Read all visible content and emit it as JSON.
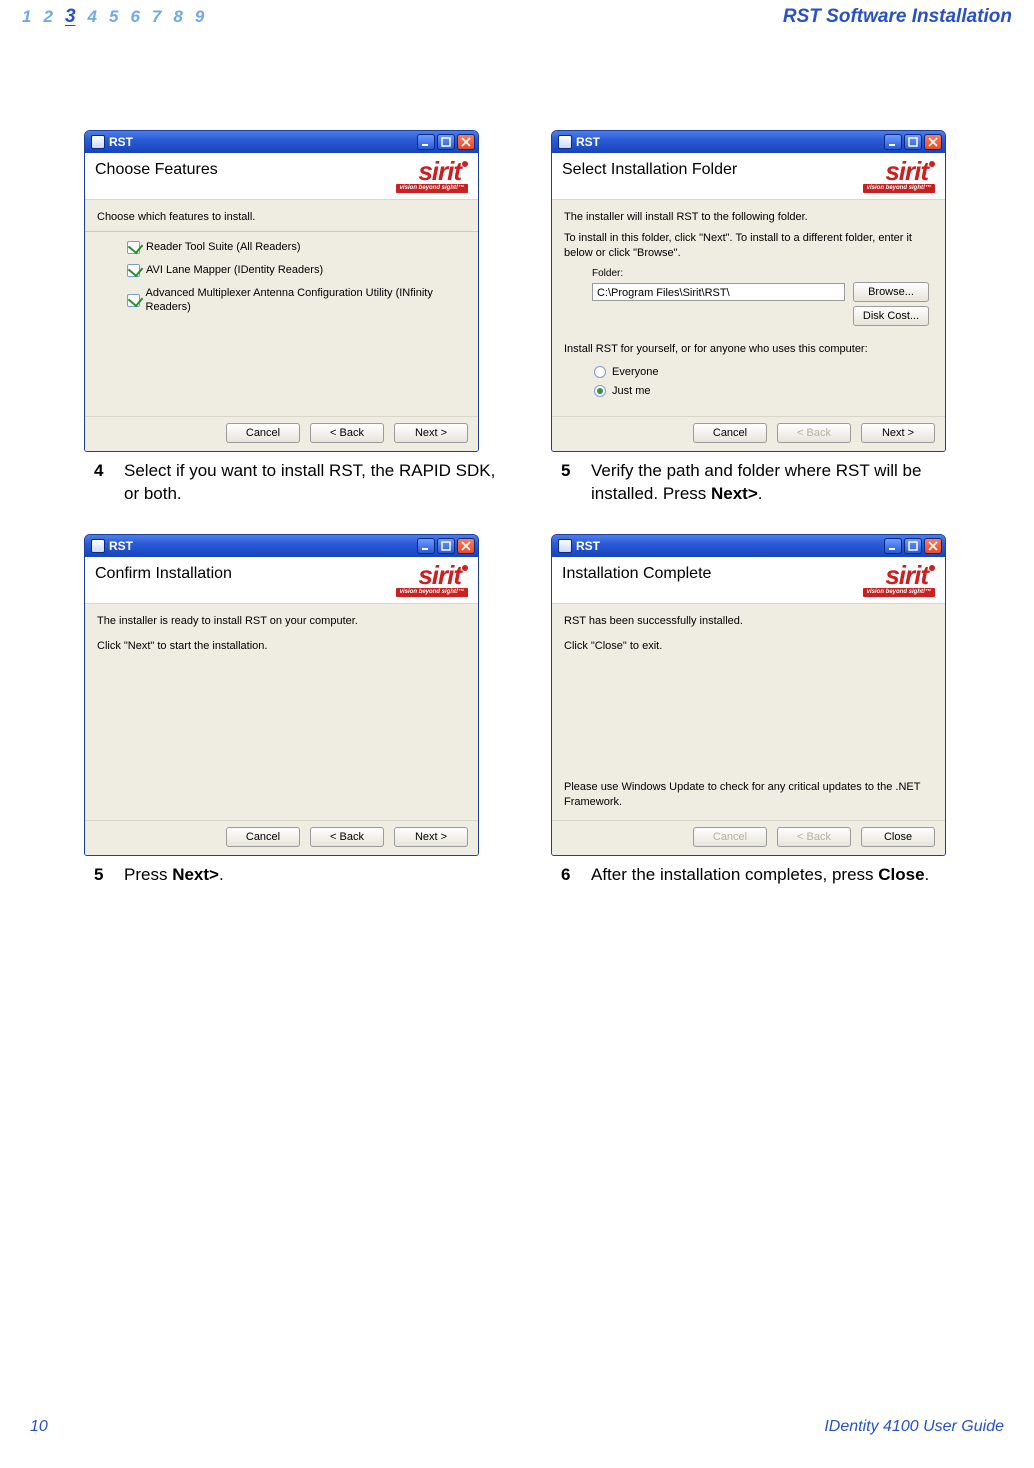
{
  "header": {
    "chapters": [
      "1",
      "2",
      "3",
      "4",
      "5",
      "6",
      "7",
      "8",
      "9"
    ],
    "current": "3",
    "title": "RST Software Installation"
  },
  "logo": {
    "word": "sirit",
    "tag": "vision beyond sight!™"
  },
  "winbuttons": {
    "min": "_",
    "max": "□",
    "close": "×"
  },
  "dialogs": {
    "d1": {
      "title": "RST",
      "heading": "Choose Features",
      "text1": "Choose which features to install.",
      "features": [
        "Reader Tool Suite (All Readers)",
        "AVI Lane Mapper (IDentity Readers)",
        "Advanced Multiplexer Antenna Configuration Utility (INfinity Readers)"
      ],
      "btn_cancel": "Cancel",
      "btn_back": "< Back",
      "btn_next": "Next >"
    },
    "d2": {
      "title": "RST",
      "heading": "Select Installation Folder",
      "text1": "The installer will install RST to the following folder.",
      "text2": "To install in this folder, click \"Next\". To install to a different folder, enter it below or click \"Browse\".",
      "folder_lbl": "Folder:",
      "folder_val": "C:\\Program Files\\Sirit\\RST\\",
      "btn_browse": "Browse...",
      "btn_diskcost": "Disk Cost...",
      "share_lbl": "Install RST for yourself, or for anyone who uses this computer:",
      "opt_everyone": "Everyone",
      "opt_justme": "Just me",
      "btn_cancel": "Cancel",
      "btn_back": "< Back",
      "btn_next": "Next >"
    },
    "d3": {
      "title": "RST",
      "heading": "Confirm Installation",
      "text1": "The installer is ready to install RST on your computer.",
      "text2": "Click \"Next\" to start the installation.",
      "btn_cancel": "Cancel",
      "btn_back": "< Back",
      "btn_next": "Next >"
    },
    "d4": {
      "title": "RST",
      "heading": "Installation Complete",
      "text1": "RST has been successfully installed.",
      "text2": "Click \"Close\" to exit.",
      "text3": "Please use Windows Update to check for any critical updates to the .NET Framework.",
      "btn_cancel": "Cancel",
      "btn_back": "< Back",
      "btn_close": "Close"
    }
  },
  "captions": {
    "c1": {
      "n": "4",
      "t": "Select if you want to install RST, the RAPID SDK, or both."
    },
    "c2": {
      "n": "5",
      "t": "Verify the path and folder where RST will be installed. Press ",
      "b": "Next>",
      "end": "."
    },
    "c3": {
      "n": "5",
      "t": "Press ",
      "b": "Next>",
      "end": "."
    },
    "c4": {
      "n": "6",
      "t": "After the installation completes, press ",
      "b": "Close",
      "end": "."
    }
  },
  "footer": {
    "page": "10",
    "guide": "IDentity 4100 User Guide"
  }
}
